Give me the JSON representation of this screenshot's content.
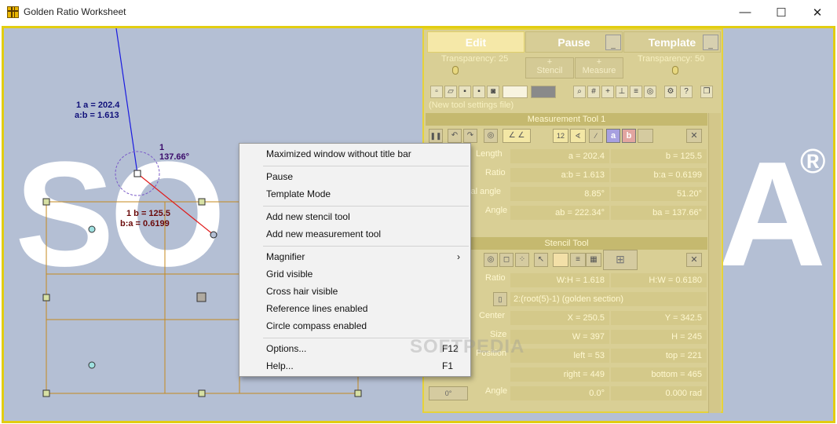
{
  "window": {
    "title": "Golden Ratio Worksheet",
    "minimize_glyph": "—",
    "maximize_glyph": "☐",
    "close_glyph": "✕"
  },
  "canvas": {
    "watermark_left": "SO",
    "watermark_right": "A",
    "watermark_mark": "®",
    "softpedia_watermark": "SOFTPEDIA",
    "annotations": {
      "a_label": "1 a = 202.4",
      "ab_label": "a:b = 1.613",
      "angle_num": "1",
      "angle_value": "137.66°",
      "b_label": "1 b = 125.5",
      "ba_label": "b:a = 0.6199"
    }
  },
  "context_menu": {
    "items": [
      {
        "label": "Maximized window without title bar",
        "shortcut": ""
      },
      {
        "label": "Pause",
        "shortcut": ""
      },
      {
        "label": "Template Mode",
        "shortcut": ""
      },
      {
        "label": "Add new stencil tool",
        "shortcut": ""
      },
      {
        "label": "Add new measurement tool",
        "shortcut": ""
      },
      {
        "label": "Magnifier",
        "shortcut": "›"
      },
      {
        "label": "Grid visible",
        "shortcut": ""
      },
      {
        "label": "Cross hair visible",
        "shortcut": ""
      },
      {
        "label": "Reference lines enabled",
        "shortcut": ""
      },
      {
        "label": "Circle compass enabled",
        "shortcut": ""
      },
      {
        "label": "Options...",
        "shortcut": "F12"
      },
      {
        "label": "Help...",
        "shortcut": "F1"
      }
    ]
  },
  "panel": {
    "tabs": {
      "edit": "Edit",
      "pause": "Pause",
      "template": "Template",
      "tab_btn": "_"
    },
    "transparency_left": "Transparency: 25",
    "transparency_right": "Transparency: 50",
    "stencil_btn": "Stencil",
    "measure_btn": "Measure",
    "plus": "+",
    "settings_file": "(New tool settings file)",
    "measurement_tool": {
      "title": "Measurement Tool 1",
      "rows": [
        {
          "label": "Length",
          "a": "a = 202.4",
          "b": "b = 125.5"
        },
        {
          "label": "Ratio",
          "a": "a:b = 1.613",
          "b": "b:a = 0.6199"
        },
        {
          "label": "cal angle",
          "a": "8.85°",
          "b": "51.20°"
        },
        {
          "label": "Angle",
          "a": "ab = 222.34°",
          "b": "ba = 137.66°"
        }
      ],
      "btn_a": "a",
      "btn_b": "b",
      "btn_12": "12",
      "close": "✕"
    },
    "stencil_tool": {
      "title": "Stencil Tool",
      "ratio_label": "Ratio",
      "wh": "W:H = 1.618",
      "hw": "H:W = 0.6180",
      "section": "2:(root(5)-1)  (golden section)",
      "center_label": "Center",
      "x": "X = 250.5",
      "y": "Y = 342.5",
      "size_label": "Size",
      "w": "W = 397",
      "h": "H = 245",
      "position_label": "Position",
      "left": "left = 53",
      "top": "top = 221",
      "right": "right = 449",
      "bottom": "bottom = 465",
      "angle_label": "Angle",
      "deg": "0.0°",
      "rad": "0.000 rad",
      "zero_deg_btn": "0°",
      "close": "✕"
    }
  }
}
